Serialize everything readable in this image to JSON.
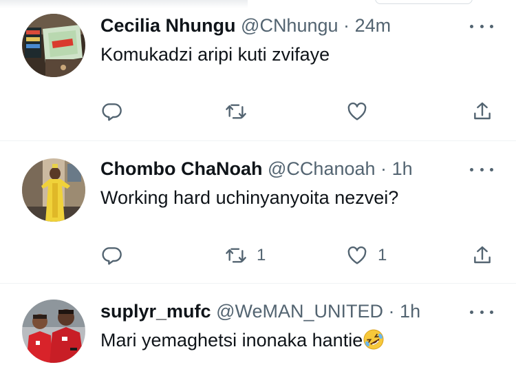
{
  "tweets": [
    {
      "name": "Cecilia Nhungu",
      "handle": "@CNhungu",
      "separator": "·",
      "time": "24m",
      "text": "Komukadzi aripi kuti zvifaye",
      "reply_count": "",
      "retweet_count": "",
      "like_count": ""
    },
    {
      "name": "Chombo ChaNoah",
      "handle": "@CChanoah",
      "separator": "·",
      "time": "1h",
      "text": "Working hard uchinyanyoita nezvei?",
      "reply_count": "",
      "retweet_count": "1",
      "like_count": "1"
    },
    {
      "name": "suplyr_mufc",
      "handle": "@WeMAN_UNITED",
      "separator": "·",
      "time": "1h",
      "text": "Mari yemaghetsi inonaka hantie",
      "emoji": "rolling-on-floor-laughing-emoji"
    }
  ],
  "icons": {
    "reply": "reply-icon",
    "retweet": "retweet-icon",
    "like": "heart-icon",
    "share": "share-icon",
    "more": "more-options-icon"
  },
  "colors": {
    "text": "#0f1419",
    "secondary": "#536471",
    "divider": "#eff3f4"
  }
}
